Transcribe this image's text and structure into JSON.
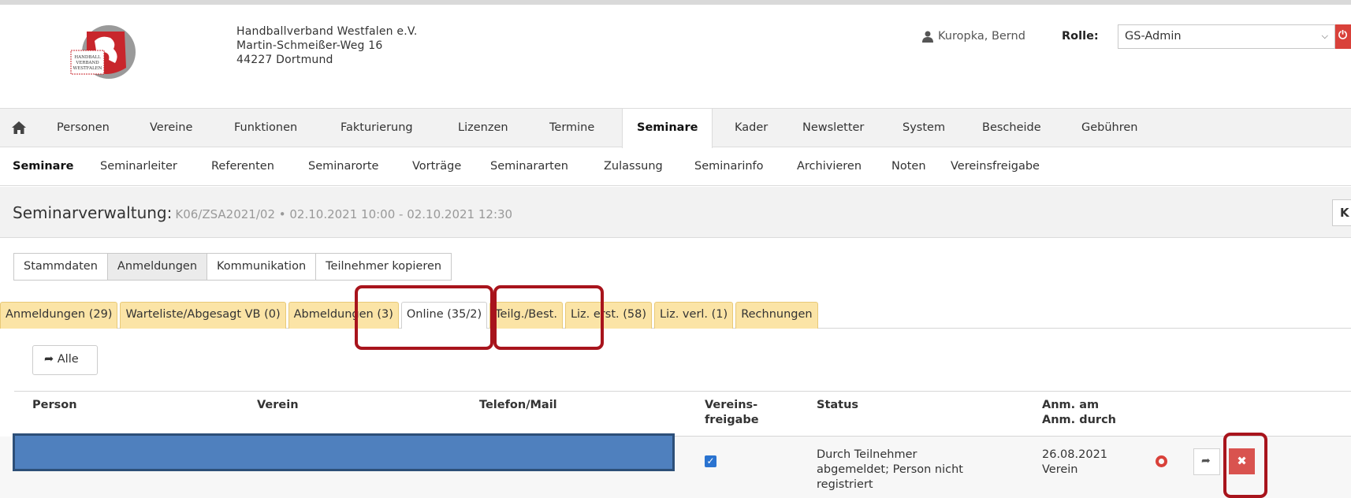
{
  "header": {
    "org_lines": [
      "Handballverband Westfalen e.V.",
      "Martin-Schmeißer-Weg 16",
      "44227 Dortmund"
    ],
    "user_name": "Kuropka, Bernd",
    "role_label": "Rolle:",
    "role_value": "GS-Admin",
    "power_icon": "power-icon",
    "colors": {
      "accent_red": "#d9413a",
      "tab_yellow": "#fbe4a6",
      "highlight": "#a8141c",
      "redaction": "#4f80be"
    }
  },
  "mainnav": {
    "items": [
      "Personen",
      "Vereine",
      "Funktionen",
      "Fakturierung",
      "Lizenzen",
      "Termine",
      "Seminare",
      "Kader",
      "Newsletter",
      "System",
      "Bescheide",
      "Gebühren"
    ],
    "active": "Seminare"
  },
  "subnav": {
    "items": [
      "Seminare",
      "Seminarleiter",
      "Referenten",
      "Seminarorte",
      "Vorträge",
      "Seminararten",
      "Zulassung",
      "Seminarinfo",
      "Archivieren",
      "Noten",
      "Vereinsfreigabe"
    ],
    "active": "Seminare"
  },
  "page": {
    "title": "Seminarverwaltung:",
    "subtitle": "K06/ZSA2021/02 • 02.10.2021 10:00 - 02.10.2021 12:30",
    "right_btn": "K"
  },
  "section_tabs": [
    "Stammdaten",
    "Anmeldungen",
    "Kommunikation",
    "Teilnehmer kopieren"
  ],
  "section_tab_active": "Anmeldungen",
  "sub_tabs": [
    "Anmeldungen (29)",
    "Warteliste/Abgesagt VB (0)",
    "Abmeldungen (3)",
    "Online (35/2)",
    "Teilg./Best.",
    "Liz. erst. (58)",
    "Liz. verl. (1)",
    "Rechnungen"
  ],
  "sub_tab_active": "Online (35/2)",
  "alle_label": "Alle",
  "table": {
    "headers": {
      "person": "Person",
      "verein": "Verein",
      "telefon": "Telefon/Mail",
      "vereinsfreigabe_1": "Vereins-",
      "vereinsfreigabe_2": "freigabe",
      "status": "Status",
      "anm_1": "Anm. am",
      "anm_2": "Anm. durch"
    },
    "row": {
      "vereinsfreigabe_checked": true,
      "status_lines": [
        "Durch Teilnehmer",
        "abgemeldet; Person nicht",
        "registriert"
      ],
      "anm_date": "26.08.2021",
      "anm_by": "Verein"
    }
  }
}
